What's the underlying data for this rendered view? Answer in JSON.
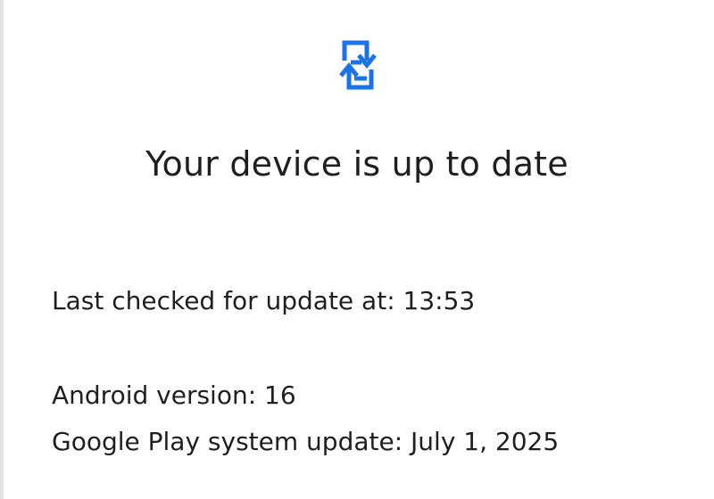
{
  "icon": {
    "name": "system-update-icon",
    "color": "#1a73e8"
  },
  "status": {
    "title": "Your device is up to date"
  },
  "details": {
    "last_checked": "Last checked for update at: 13:53",
    "android_version": "Android version: 16",
    "play_system_update": "Google Play system update: July 1, 2025"
  }
}
